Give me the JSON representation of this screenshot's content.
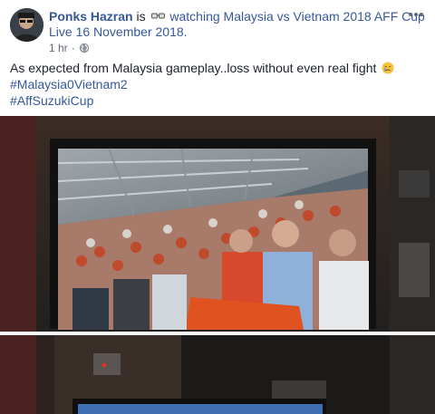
{
  "post": {
    "author": "Ponks Hazran",
    "verb": "is",
    "activity": "watching Malaysia vs Vietnam 2018 AFF Cup",
    "event_date": "Live 16 November 2018.",
    "time": "1 hr",
    "dot": "·",
    "text": "As expected from Malaysia gameplay..loss without even real fight",
    "hashtags": [
      "#Malaysia0Vietnam2",
      "#AffSuzukiCup"
    ],
    "icons": {
      "activity": "watching-glasses-icon",
      "privacy": "globe-icon",
      "reaction": "crying-face-icon",
      "menu": "more-options-icon"
    },
    "colors": {
      "link": "#365899",
      "text": "#1d2129",
      "meta": "#606770"
    }
  }
}
